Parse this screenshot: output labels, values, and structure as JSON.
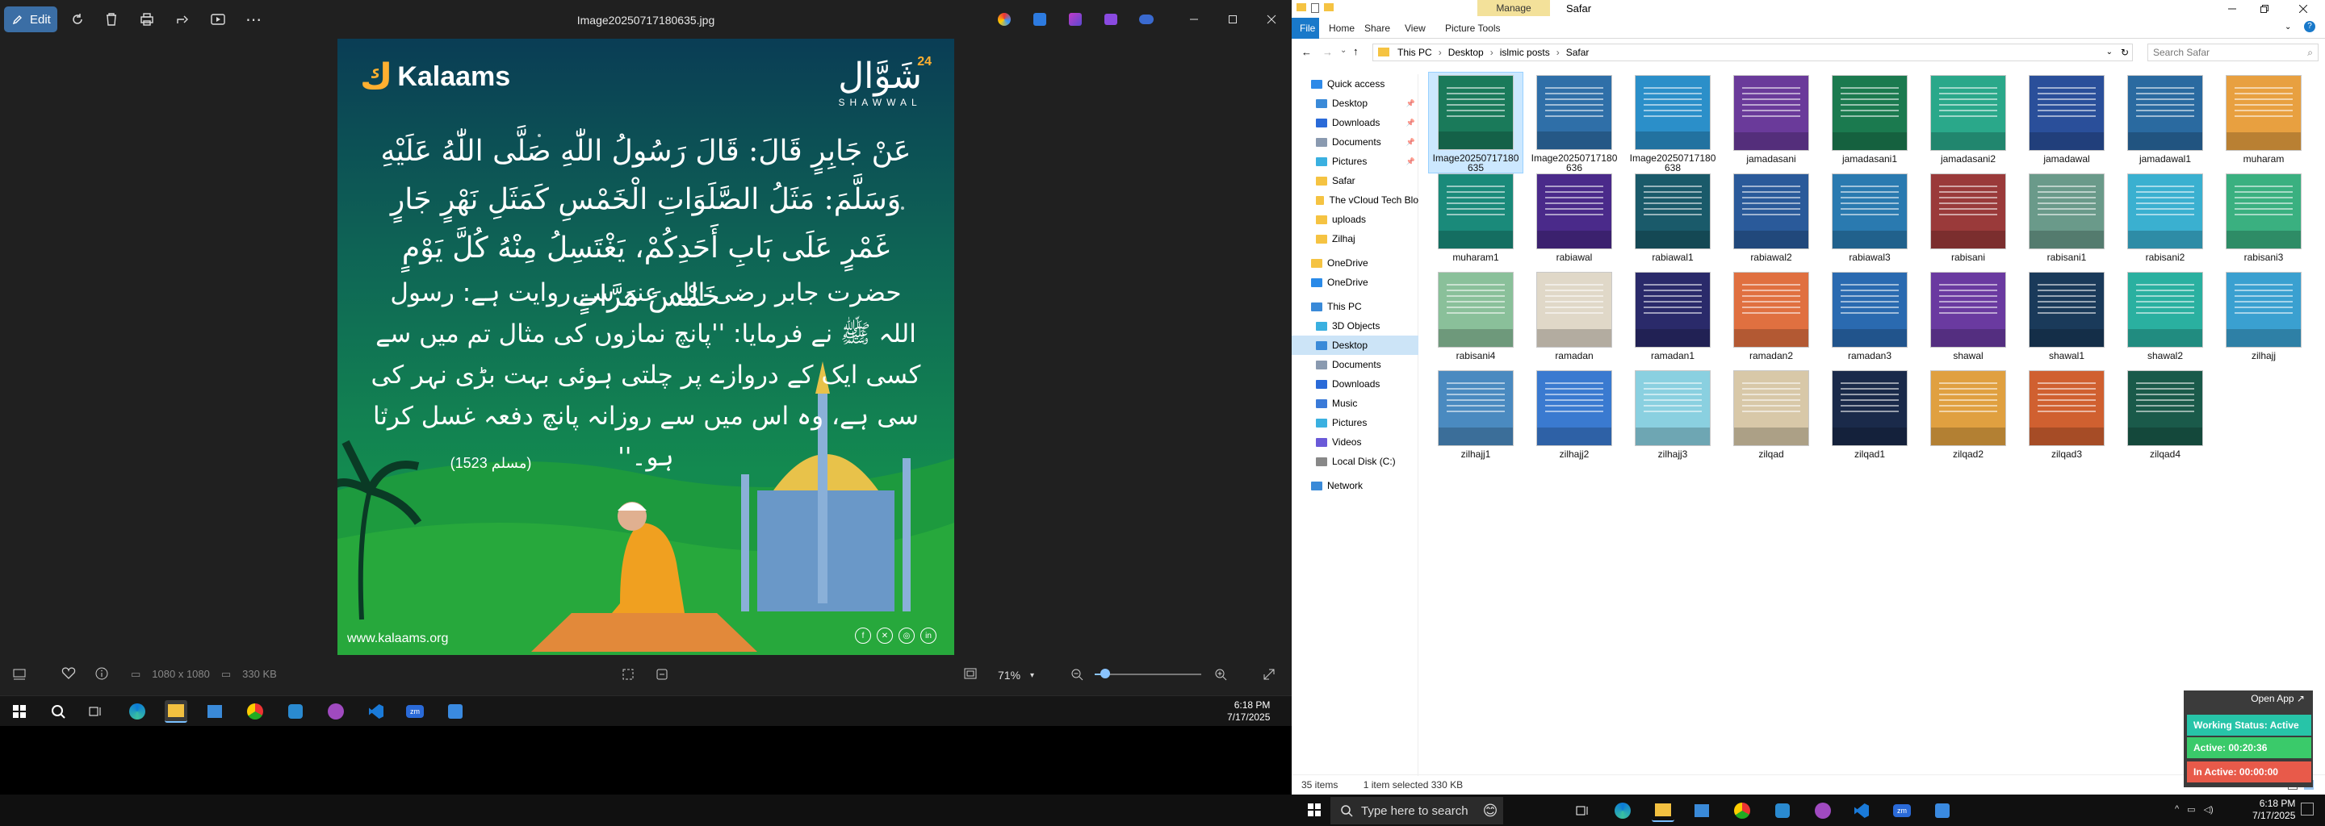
{
  "photos": {
    "edit_label": "Edit",
    "title": "Image20250717180635.jpg",
    "info": {
      "dimensions": "1080 x 1080",
      "size": "330 KB"
    },
    "zoom": "71%",
    "zoom_fraction": 0.1
  },
  "post": {
    "brand": "Kalaams",
    "badge_num": "24",
    "badge_ar": "شَوَّال",
    "badge_en": "SHAWWAL",
    "arabic": "عَنْ جَابِرٍ قَالَ: قَالَ رَسُولُ اللّٰهِ صَلَّى اللّٰهُ عَلَيْهِ وَسَلَّمَ: مَثَلُ الصَّلَوَاتِ الْخَمْسِ كَمَثَلِ نَهْرٍ جَارٍ غَمْرٍ عَلَى بَابِ أَحَدِكُمْ، يَغْتَسِلُ مِنْهُ كُلَّ يَوْمٍ خَمْسَ مَرَّاتٍ",
    "urdu": "حضرت جابر رضی اللہ عنہ سے روایت ہے: رسول اللہ ﷺ نے فرمایا: ''پانچ نمازوں کی مثال تم میں سے کسی ایک کے دروازے پر چلتی ہوئی بہت بڑی نہر کی سی ہے، وہ اس میں سے روزانہ پانچ دفعہ غسل کرتا ہو۔''",
    "reference": "(مسلم 1523)",
    "website": "www.kalaams.org"
  },
  "taskbar_small": {
    "time": "6:18 PM",
    "date": "7/17/2025"
  },
  "explorer": {
    "manage": "Manage",
    "folder_title": "Safar",
    "tabs": [
      "File",
      "Home",
      "Share",
      "View",
      "Picture Tools"
    ],
    "breadcrumb": [
      "This PC",
      "Desktop",
      "islmic posts",
      "Safar"
    ],
    "search_placeholder": "Search Safar",
    "nav": [
      {
        "label": "Quick access",
        "level": 0,
        "kind": "star"
      },
      {
        "label": "Desktop",
        "level": 1,
        "kind": "desk",
        "pin": true
      },
      {
        "label": "Downloads",
        "level": 1,
        "kind": "down",
        "pin": true
      },
      {
        "label": "Documents",
        "level": 1,
        "kind": "doc",
        "pin": true
      },
      {
        "label": "Pictures",
        "level": 1,
        "kind": "pic",
        "pin": true
      },
      {
        "label": "Safar",
        "level": 1,
        "kind": "folder"
      },
      {
        "label": "The vCloud Tech Blo",
        "level": 1,
        "kind": "folder"
      },
      {
        "label": "uploads",
        "level": 1,
        "kind": "folder"
      },
      {
        "label": "Zilhaj",
        "level": 1,
        "kind": "folder"
      },
      {
        "label": "OneDrive",
        "level": 0,
        "kind": "folder"
      },
      {
        "label": "OneDrive",
        "level": 0,
        "kind": "cloud"
      },
      {
        "label": "This PC",
        "level": 0,
        "kind": "pc"
      },
      {
        "label": "3D Objects",
        "level": 1,
        "kind": "obj"
      },
      {
        "label": "Desktop",
        "level": 1,
        "kind": "desk",
        "sel": true
      },
      {
        "label": "Documents",
        "level": 1,
        "kind": "doc"
      },
      {
        "label": "Downloads",
        "level": 1,
        "kind": "down"
      },
      {
        "label": "Music",
        "level": 1,
        "kind": "music"
      },
      {
        "label": "Pictures",
        "level": 1,
        "kind": "pic"
      },
      {
        "label": "Videos",
        "level": 1,
        "kind": "vid"
      },
      {
        "label": "Local Disk (C:)",
        "level": 1,
        "kind": "disk"
      },
      {
        "label": "Network",
        "level": 0,
        "kind": "net"
      }
    ],
    "files": [
      {
        "name": "Image20250717180635",
        "color": "#1a7a5a",
        "sel": true
      },
      {
        "name": "Image20250717180636",
        "color": "#2f6fa8"
      },
      {
        "name": "Image20250717180638",
        "color": "#2b8fc9"
      },
      {
        "name": "jamadasani",
        "color": "#6a3a9a"
      },
      {
        "name": "jamadasani1",
        "color": "#1b7a4f"
      },
      {
        "name": "jamadasani2",
        "color": "#2aa88a"
      },
      {
        "name": "jamadawal",
        "color": "#2a4f9a"
      },
      {
        "name": "jamadawal1",
        "color": "#2a6aa0"
      },
      {
        "name": "muharam",
        "color": "#e8a040"
      },
      {
        "name": "muharam1",
        "color": "#1a8a7a"
      },
      {
        "name": "rabiawal",
        "color": "#4a2a8a"
      },
      {
        "name": "rabiawal1",
        "color": "#1a5a6a"
      },
      {
        "name": "rabiawal2",
        "color": "#2a5a9a"
      },
      {
        "name": "rabiawal3",
        "color": "#2a7ab0"
      },
      {
        "name": "rabisani",
        "color": "#9a3a3a"
      },
      {
        "name": "rabisani1",
        "color": "#6a9a8a"
      },
      {
        "name": "rabisani2",
        "color": "#3ab0d0"
      },
      {
        "name": "rabisani3",
        "color": "#3ab080"
      },
      {
        "name": "rabisani4",
        "color": "#8ac09a"
      },
      {
        "name": "ramadan",
        "color": "#e0d8c8"
      },
      {
        "name": "ramadan1",
        "color": "#2a2a6a"
      },
      {
        "name": "ramadan2",
        "color": "#e07040"
      },
      {
        "name": "ramadan3",
        "color": "#2a6ab0"
      },
      {
        "name": "shawal",
        "color": "#6a3aa0"
      },
      {
        "name": "shawal1",
        "color": "#1a3a5a"
      },
      {
        "name": "shawal2",
        "color": "#2ab0a0"
      },
      {
        "name": "zilhajj",
        "color": "#3aa0d0"
      },
      {
        "name": "zilhajj1",
        "color": "#4a8ac0"
      },
      {
        "name": "zilhajj2",
        "color": "#3a7ad0"
      },
      {
        "name": "zilhajj3",
        "color": "#8ad0e0"
      },
      {
        "name": "zilqad",
        "color": "#d8c8a8"
      },
      {
        "name": "zilqad1",
        "color": "#1a2a4a"
      },
      {
        "name": "zilqad2",
        "color": "#e0a040"
      },
      {
        "name": "zilqad3",
        "color": "#d06030"
      },
      {
        "name": "zilqad4",
        "color": "#1a5a4a"
      }
    ],
    "status": {
      "items": "35 items",
      "selected": "1 item selected  330 KB"
    }
  },
  "widget": {
    "open": "Open App ↗",
    "working": "Working Status: Active",
    "active": "Active: 00:20:36",
    "inactive": "In Active: 00:00:00"
  },
  "taskbar": {
    "search_placeholder": "Type here to search",
    "time": "6:18 PM",
    "date": "7/17/2025"
  }
}
